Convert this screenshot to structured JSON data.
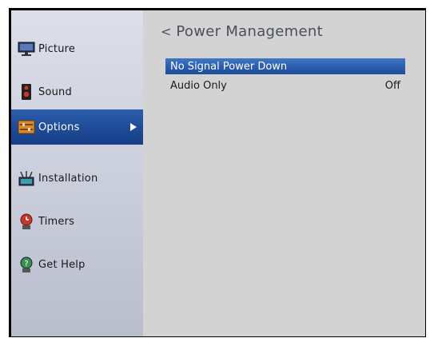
{
  "sidebar": {
    "items": [
      {
        "label": "Picture",
        "icon": "tv-picture-icon"
      },
      {
        "label": "Sound",
        "icon": "speaker-icon"
      },
      {
        "label": "Options",
        "icon": "options-sliders-icon"
      },
      {
        "label": "Installation",
        "icon": "installation-icon"
      },
      {
        "label": "Timers",
        "icon": "timer-icon"
      },
      {
        "label": "Get Help",
        "icon": "help-icon"
      }
    ],
    "selected": "Options"
  },
  "main": {
    "title": "Power Management",
    "back_glyph": "<",
    "options": [
      {
        "label": "No Signal Power Down",
        "value": ""
      },
      {
        "label": "Audio Only",
        "value": "Off"
      }
    ]
  },
  "colors": {
    "selection_blue": "#2b5fb0",
    "content_bg": "#d3d3d4",
    "sidebar_bg": "#c8ccd9"
  }
}
